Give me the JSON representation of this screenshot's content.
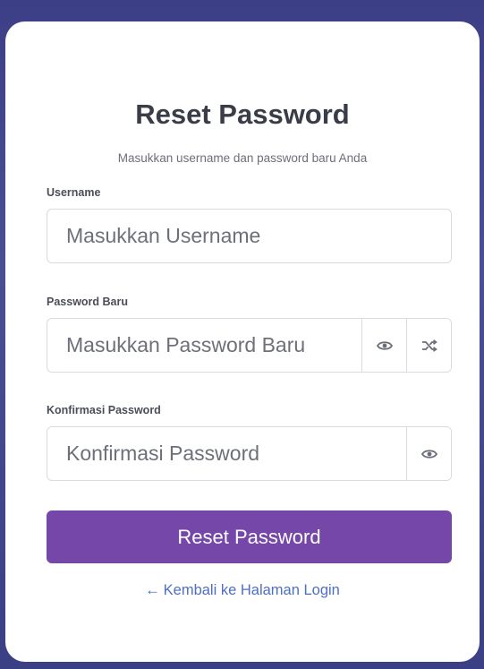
{
  "card": {
    "title": "Reset Password",
    "subtitle": "Masukkan username dan password baru Anda"
  },
  "form": {
    "username": {
      "label": "Username",
      "placeholder": "Masukkan Username"
    },
    "new_password": {
      "label": "Password Baru",
      "placeholder": "Masukkan Password Baru",
      "toggle_icon": "eye-icon",
      "generate_icon": "shuffle-icon"
    },
    "confirm_password": {
      "label": "Konfirmasi Password",
      "placeholder": "Konfirmasi Password",
      "toggle_icon": "eye-icon"
    },
    "submit_label": "Reset Password"
  },
  "back_link": {
    "arrow": "←",
    "label": "Kembali ke Halaman Login"
  },
  "colors": {
    "background": "#3d3f86",
    "primary_button": "#7447a9",
    "link": "#4d6fc2"
  }
}
